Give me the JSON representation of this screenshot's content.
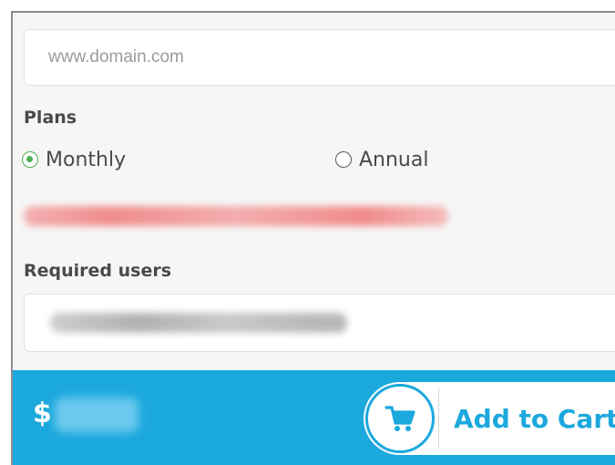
{
  "domain": {
    "placeholder": "www.domain.com",
    "value": ""
  },
  "plans": {
    "label": "Plans",
    "options": [
      {
        "label": "Monthly",
        "selected": true
      },
      {
        "label": "Annual",
        "selected": false
      }
    ]
  },
  "users": {
    "label": "Required users"
  },
  "cart": {
    "currency_symbol": "$",
    "button_label": "Add to Cart",
    "accent_color": "#1ba8dd"
  },
  "icons": {
    "cart": "shopping-cart-icon",
    "radio_checked": "radio-checked-icon",
    "radio_unchecked": "radio-unchecked-icon"
  }
}
